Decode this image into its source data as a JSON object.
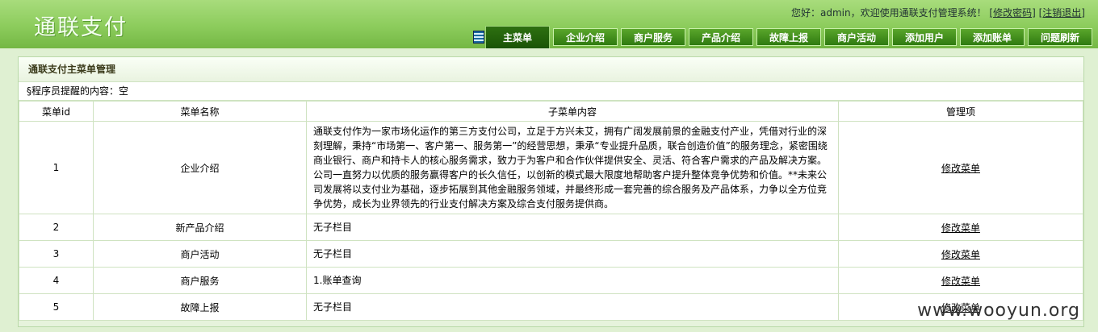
{
  "app": {
    "logo": "通联支付",
    "welcome_prefix": "您好：admin，欢迎使用通联支付管理系统！",
    "change_password": "[修改密码]",
    "logout": "[注销退出]"
  },
  "nav": {
    "items": [
      {
        "label": "主菜单",
        "active": true
      },
      {
        "label": "企业介绍"
      },
      {
        "label": "商户服务"
      },
      {
        "label": "产品介绍"
      },
      {
        "label": "故障上报"
      },
      {
        "label": "商户活动"
      },
      {
        "label": "添加用户"
      },
      {
        "label": "添加账单"
      },
      {
        "label": "问题刷新"
      }
    ]
  },
  "panel": {
    "title": "通联支付主菜单管理",
    "note": "§程序员提醒的内容：空"
  },
  "table": {
    "headers": [
      "菜单id",
      "菜单名称",
      "子菜单内容",
      "管理项"
    ],
    "rows": [
      {
        "id": "1",
        "name": "企业介绍",
        "content": "通联支付作为一家市场化运作的第三方支付公司，立足于方兴未艾，拥有广阔发展前景的金融支付产业，凭借对行业的深刻理解，秉持“市场第一、客户第一、服务第一”的经营思想，秉承“专业提升品质，联合创造价值”的服务理念，紧密围绕商业银行、商户和持卡人的核心服务需求，致力于为客户和合作伙伴提供安全、灵活、符合客户需求的产品及解决方案。公司一直努力以优质的服务赢得客户的长久信任，以创新的模式最大限度地帮助客户提升整体竞争优势和价值。**未来公司发展将以支付业为基础，逐步拓展到其他金融服务领域，并最终形成一套完善的综合服务及产品体系，力争以全方位竞争优势，成长为业界领先的行业支付解决方案及综合支付服务提供商。",
        "action": "修改菜单"
      },
      {
        "id": "2",
        "name": "新产品介绍",
        "content": "无子栏目",
        "action": "修改菜单"
      },
      {
        "id": "3",
        "name": "商户活动",
        "content": "无子栏目",
        "action": "修改菜单"
      },
      {
        "id": "4",
        "name": "商户服务",
        "content": "1.账单查询",
        "action": "修改菜单"
      },
      {
        "id": "5",
        "name": "故障上报",
        "content": "无子栏目",
        "action": "修改菜单"
      }
    ]
  },
  "watermark": "www.wooyun.org"
}
